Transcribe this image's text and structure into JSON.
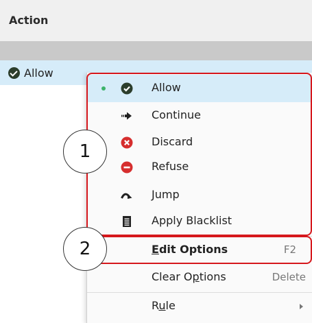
{
  "table": {
    "header": "Action",
    "selected_row_label": "Allow"
  },
  "menu": {
    "items": [
      {
        "label": "Allow",
        "icon": "check-circle-icon",
        "selected": true
      },
      {
        "label": "Continue",
        "icon": "arrow-right-icon"
      },
      {
        "label": "Discard",
        "icon": "close-circle-icon"
      },
      {
        "label": "Refuse",
        "icon": "minus-circle-icon"
      },
      {
        "label": "Jump",
        "icon": "jump-arrow-icon"
      },
      {
        "label": "Apply Blacklist",
        "icon": "list-icon"
      }
    ],
    "edit_options": {
      "prefix": "",
      "underline": "E",
      "rest": "dit Options",
      "shortcut": "F2"
    },
    "clear_options": {
      "prefix": "Clear O",
      "underline": "p",
      "rest": "tions",
      "shortcut": "Delete"
    },
    "rule": {
      "prefix": "R",
      "underline": "u",
      "rest": "le"
    }
  },
  "annotations": {
    "badge_1": "1",
    "badge_2": "2",
    "highlight_color": "#d6171c"
  }
}
